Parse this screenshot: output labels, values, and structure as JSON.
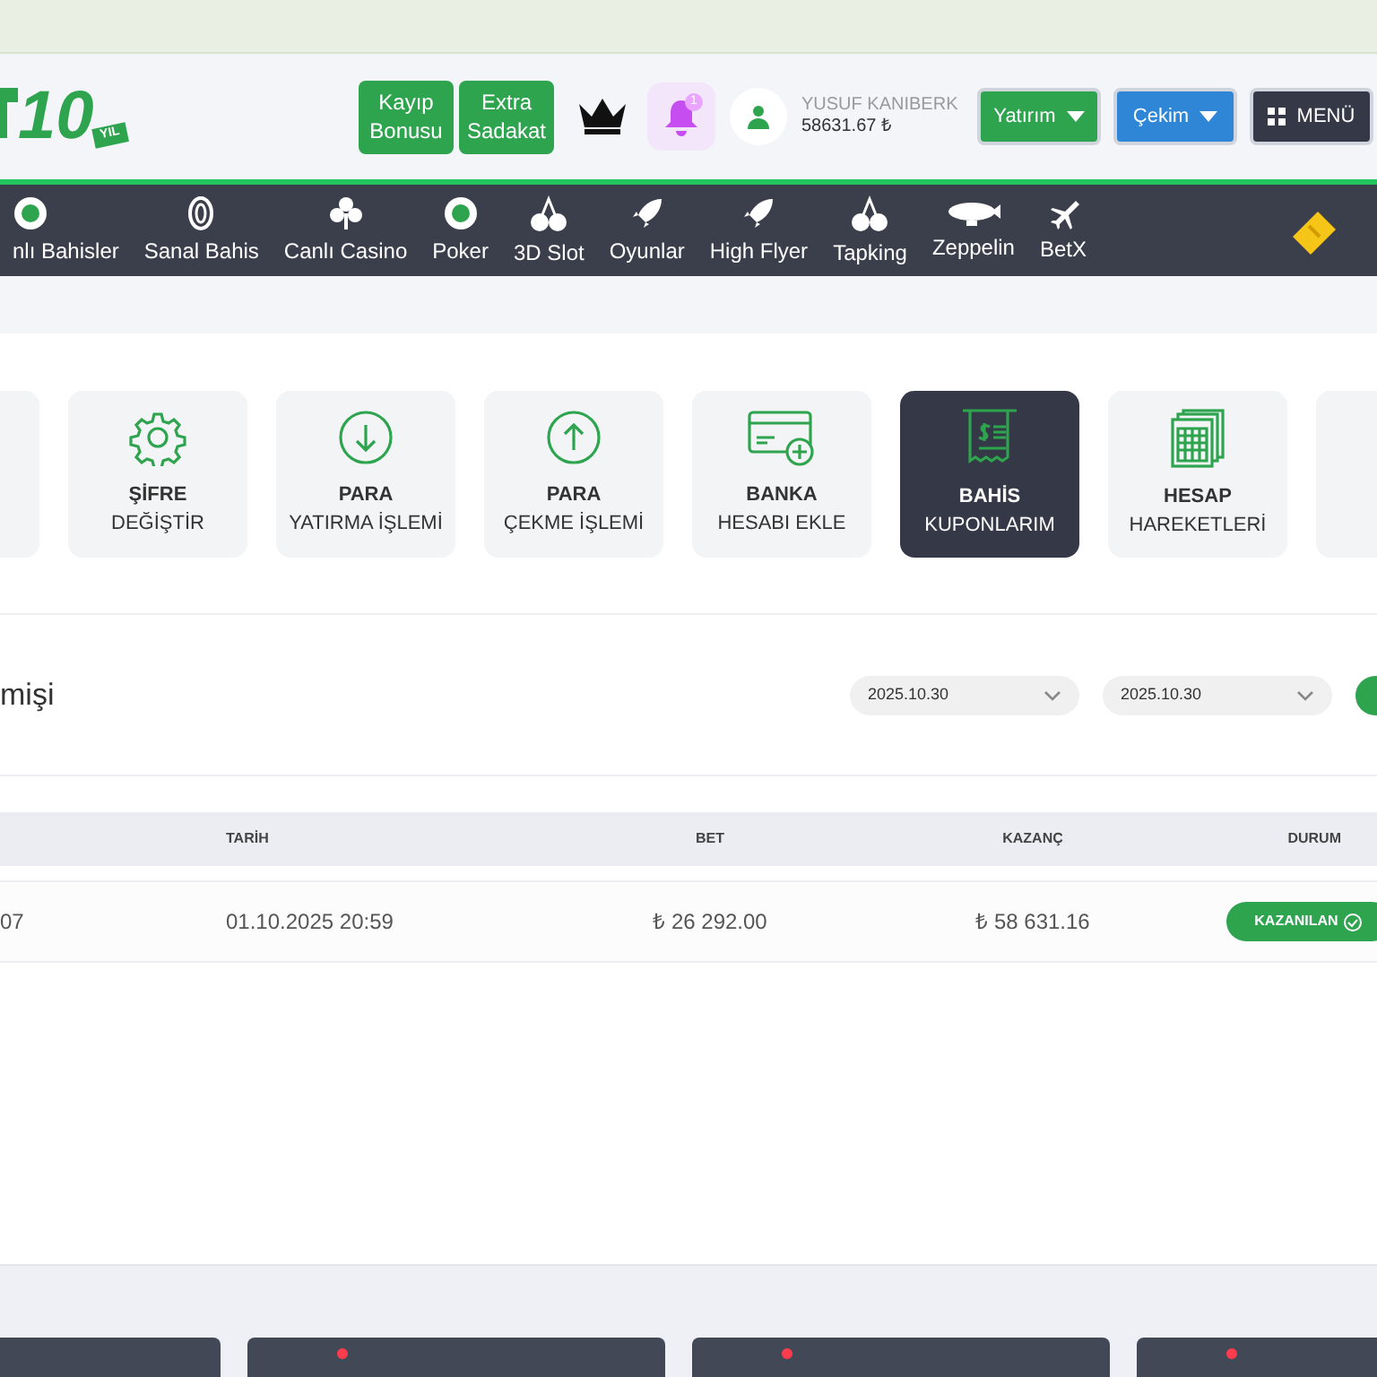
{
  "logo": {
    "text": "10",
    "badge": "YIL"
  },
  "promo_buttons": [
    {
      "line1": "Kayıp",
      "line2": "Bonusu"
    },
    {
      "line1": "Extra",
      "line2": "Sadakat"
    }
  ],
  "notifications": {
    "count": "1"
  },
  "user": {
    "name": "YUSUF KANIBERK",
    "balance": "58631.67 ₺"
  },
  "header_buttons": [
    {
      "label": "Yatırım",
      "kind": "deposit"
    },
    {
      "label": "Çekim",
      "kind": "withdraw"
    },
    {
      "label": "MENÜ",
      "kind": "menu"
    }
  ],
  "nav": [
    {
      "label": "nlı Bahisler",
      "kind": "chip"
    },
    {
      "label": "Sanal Bahis",
      "kind": "ring"
    },
    {
      "label": "Canlı Casino",
      "kind": "clubs"
    },
    {
      "label": "Poker",
      "kind": "chip"
    },
    {
      "label": "3D Slot",
      "kind": "cherry"
    },
    {
      "label": "Oyunlar",
      "kind": "rocket"
    },
    {
      "label": "High Flyer",
      "kind": "rocket"
    },
    {
      "label": "Tapking",
      "kind": "cherry"
    },
    {
      "label": "Zeppelin",
      "kind": "zeppelin"
    },
    {
      "label": "BetX",
      "kind": "plane"
    }
  ],
  "cards": [
    {
      "title": "ŞİFRE",
      "subtitle": "DEĞİŞTİR",
      "kind": "gear",
      "selected": false
    },
    {
      "title": "PARA",
      "subtitle": "YATIRMA İŞLEMİ",
      "kind": "down",
      "selected": false
    },
    {
      "title": "PARA",
      "subtitle": "ÇEKME İŞLEMİ",
      "kind": "up",
      "selected": false
    },
    {
      "title": "BANKA",
      "subtitle": "HESABI EKLE",
      "kind": "card",
      "selected": false
    },
    {
      "title": "BAHİS",
      "subtitle": "KUPONLARIM",
      "kind": "receipt",
      "selected": true
    },
    {
      "title": "HESAP",
      "subtitle": "HAREKETLERİ",
      "kind": "sheet",
      "selected": false
    }
  ],
  "section": {
    "title": "mişi",
    "date_from": "2025.10.30",
    "date_to": "2025.10.30"
  },
  "table": {
    "columns": [
      "TARİH",
      "BET",
      "KAZANÇ",
      "DURUM"
    ],
    "rows": [
      {
        "id": "07",
        "date": "01.10.2025 20:59",
        "bet": "₺ 26 292.00",
        "win": "₺ 58 631.16",
        "status": "KAZANILAN",
        "won": true
      }
    ]
  }
}
